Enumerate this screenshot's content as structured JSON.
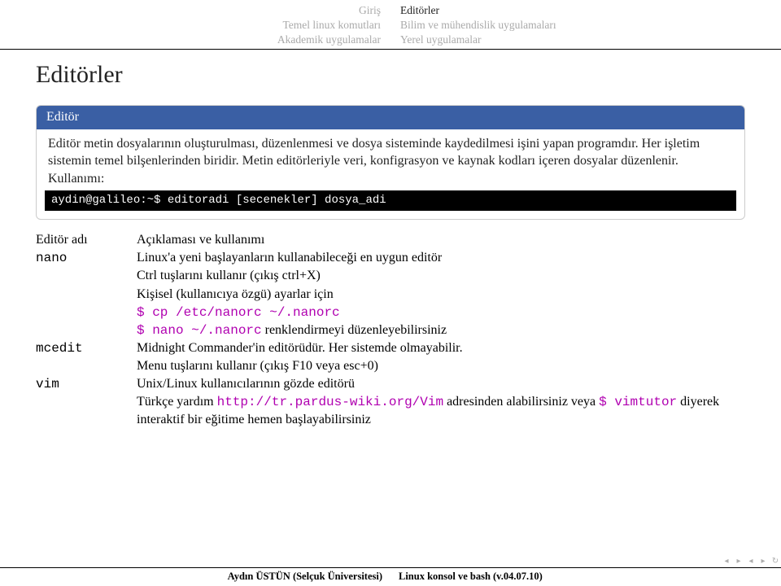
{
  "header": {
    "left": [
      "Giriş",
      "Temel linux komutları",
      "Akademik uygulamalar"
    ],
    "right": [
      "Editörler",
      "Bilim ve mühendislik uygulamaları",
      "Yerel uygulamalar"
    ]
  },
  "page_title": "Editörler",
  "block": {
    "title": "Editör",
    "p1": "Editör metin dosyalarının oluşturulması, düzenlenmesi ve dosya sisteminde kaydedilmesi işini yapan programdır. Her işletim sistemin temel bilşenlerinden biridir. Metin editörleriyle veri, konfigrasyon ve kaynak kodları içeren dosyalar düzenlenir. Kullanımı:",
    "term": "aydin@galileo:~$ editoradi [secenekler] dosya_adi"
  },
  "table": {
    "hdr": {
      "c1": "Editör adı",
      "c2": "Açıklaması ve kullanımı"
    },
    "nano": {
      "name": "nano",
      "l1": "Linux'a yeni başlayanların kullanabileceği en uygun editör",
      "l2": "Ctrl tuşlarını kullanır (çıkış ctrl+X)",
      "l3": "Kişisel (kullanıcıya özgü) ayarlar için",
      "cmd1": "$ cp /etc/nanorc ~/.nanorc",
      "cmd2_a": "$ nano ~/.nanorc",
      "cmd2_b": " renklendirmeyi düzenleyebilirsiniz"
    },
    "mcedit": {
      "name": "mcedit",
      "l1": "Midnight Commander'in editörüdür. Her sistemde olmayabilir.",
      "l2": "Menu tuşlarını kullanır (çıkış F10 veya esc+0)"
    },
    "vim": {
      "name": "vim",
      "l1": "Unix/Linux kullanıcılarının gözde editörü",
      "l2_a": "Türkçe yardım ",
      "l2_b": "http://tr.pardus-wiki.org/Vim",
      "l2_c": " adresinden alabilirsiniz veya ",
      "l2_d": "$ vimtutor",
      "l2_e": " diyerek interaktif bir eğitime hemen başlayabilirsiniz"
    }
  },
  "footer": {
    "left": "Aydın ÜSTÜN (Selçuk Üniversitesi)",
    "right": "Linux konsol ve bash (v.04.07.10)"
  },
  "nav": {
    "a": "◂",
    "b": "▸",
    "c": "◂",
    "d": "▸",
    "e": "↻"
  }
}
